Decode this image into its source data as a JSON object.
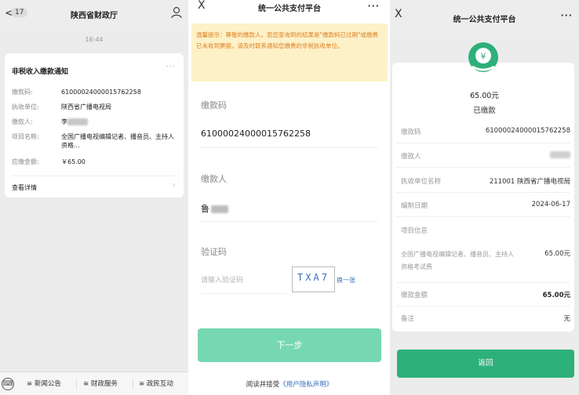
{
  "left": {
    "back_arrow": "<",
    "unread_count": "17",
    "title": "陕西省财政厅",
    "time": "16:44",
    "card": {
      "title": "非税收入缴款通知",
      "more": "···",
      "rows": [
        {
          "label": "缴款码:",
          "value": "6100002400001576225​8"
        },
        {
          "label": "执收单位:",
          "value": "陕西省广播电视局"
        },
        {
          "label": "缴款人:",
          "value": "李"
        },
        {
          "label": "项目名称:",
          "value": "全国广播电视编辑记者、播音员、主持人资格..."
        },
        {
          "label": "应缴金额:",
          "value": "￥65.00"
        }
      ],
      "detail": "查看详情",
      "detail_arrow": "›"
    },
    "footer": {
      "keyboard_icon": "⌨",
      "items": [
        "新闻公告",
        "财政服务",
        "政民互动"
      ],
      "menu_glyph": "≡"
    }
  },
  "middle": {
    "close": "X",
    "title": "统一公共支付平台",
    "more": "···",
    "notice": "温馨提示：尊敬的缴款人，若您查询到的结果是\"缴款码已过期\"或缴费已未收到票据，请及时联系通知您缴费的非税执收单位。",
    "fields": [
      {
        "label": "缴款码",
        "value": "610000240000157622​58"
      },
      {
        "label": "缴款人",
        "value": "鲁"
      },
      {
        "label": "验证码",
        "placeholder": "请输入验证码"
      }
    ],
    "captcha_text": "TXA7",
    "captcha_refresh": "换一张",
    "next_button": "下一步",
    "agree_prefix": "阅读并接受",
    "agree_link": "《用户隐私声明》"
  },
  "right": {
    "close": "X",
    "title": "统一公共支付平台",
    "more": "···",
    "logo_glyph": "¥",
    "amount": "65.00元",
    "status": "已缴款",
    "rows": [
      {
        "label": "缴款码",
        "value": "6100002400001576225​8"
      },
      {
        "label": "缴款人",
        "value": ""
      },
      {
        "label": "执收单位名称",
        "value": "211001 陕西省广播电视局"
      },
      {
        "label": "编制日期",
        "value": "2024-06-17"
      },
      {
        "label": "项目信息",
        "value": ""
      }
    ],
    "item_name": "全国广播电视编辑记者、播音员、主持人资格考试费",
    "item_amount": "65.00元",
    "total_label": "缴款金额",
    "total_value": "65.00元",
    "remark_label": "备注",
    "remark_value": "无",
    "return_button": "返回"
  },
  "colors": {
    "primary_green": "#2eb07a",
    "next_button": "#76d8b2",
    "notice_bg": "#fdf1c8",
    "notice_text": "#e08020",
    "link_blue": "#3b6fb6"
  }
}
